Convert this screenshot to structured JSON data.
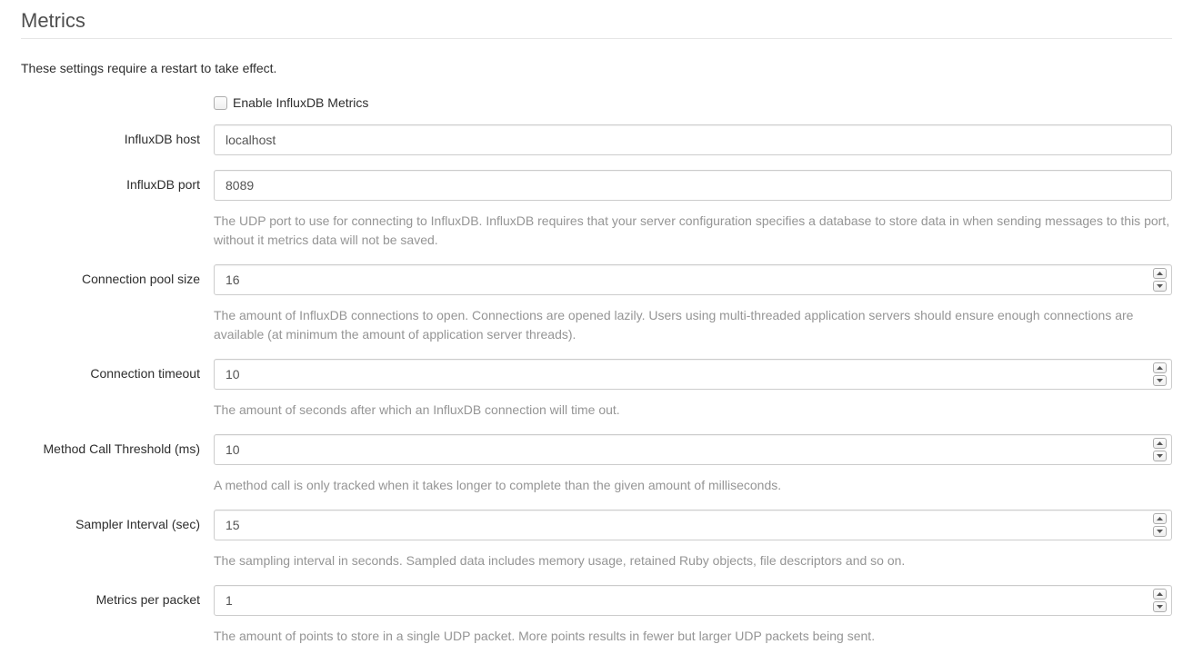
{
  "section": {
    "title": "Metrics",
    "note": "These settings require a restart to take effect."
  },
  "fields": {
    "enable": {
      "label": "Enable InfluxDB Metrics"
    },
    "host": {
      "label": "InfluxDB host",
      "value": "localhost"
    },
    "port": {
      "label": "InfluxDB port",
      "value": "8089",
      "help": "The UDP port to use for connecting to InfluxDB. InfluxDB requires that your server configuration specifies a database to store data in when sending messages to this port, without it metrics data will not be saved."
    },
    "pool": {
      "label": "Connection pool size",
      "value": "16",
      "help": "The amount of InfluxDB connections to open. Connections are opened lazily. Users using multi-threaded application servers should ensure enough connections are available (at minimum the amount of application server threads)."
    },
    "timeout": {
      "label": "Connection timeout",
      "value": "10",
      "help": "The amount of seconds after which an InfluxDB connection will time out."
    },
    "threshold": {
      "label": "Method Call Threshold (ms)",
      "value": "10",
      "help": "A method call is only tracked when it takes longer to complete than the given amount of milliseconds."
    },
    "sampler": {
      "label": "Sampler Interval (sec)",
      "value": "15",
      "help": "The sampling interval in seconds. Sampled data includes memory usage, retained Ruby objects, file descriptors and so on."
    },
    "packet": {
      "label": "Metrics per packet",
      "value": "1",
      "help": "The amount of points to store in a single UDP packet. More points results in fewer but larger UDP packets being sent."
    }
  }
}
